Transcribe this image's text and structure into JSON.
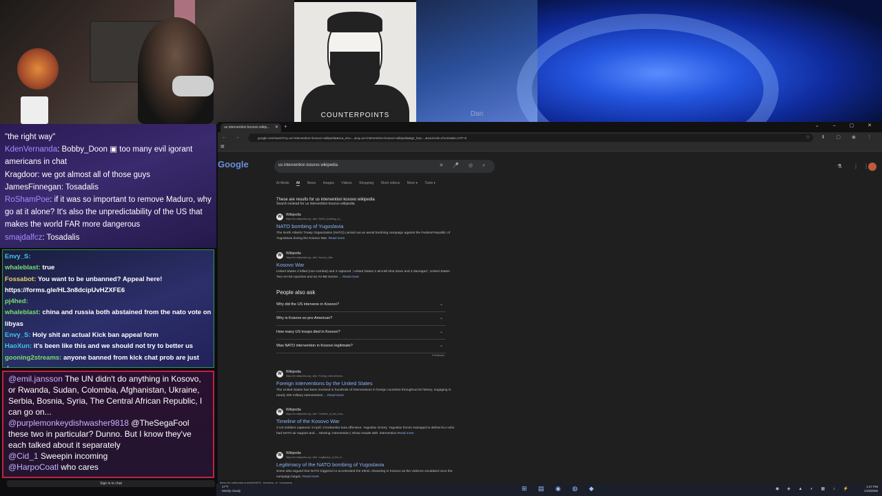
{
  "overlays": {
    "counterpoints_label": "COUNTERPOINTS",
    "dan_label": "Dan"
  },
  "chat_top": [
    {
      "user": "",
      "text": "\"the right way\""
    },
    {
      "user": "KdenVernanda",
      "text": ": Bobby_Doon ▣ too many evil igorant americans in chat"
    },
    {
      "user": "",
      "text": "Kragdoor: we got almost all of those guys"
    },
    {
      "user": "",
      "text": "JamesFinnegan: Tosadalis"
    },
    {
      "user": "RoShamPoe",
      "text": ": if it was so important to remove Maduro, why go at it alone? It's also the unpredictability of the US that makes the world FAR more dangerous"
    },
    {
      "user": "smajdalfcz",
      "text": ": Tosadalis"
    }
  ],
  "chat_mid": [
    {
      "user": "Envy_S:",
      "text": ""
    },
    {
      "user": "whaleblast:",
      "text": "true"
    },
    {
      "user": "Fossabot:",
      "text": "You want to be unbanned? Appeal here! https://forms.gle/HL3n8dcipUvHZXFE6"
    },
    {
      "user": "pj4hed:",
      "text": ""
    },
    {
      "user": "whaleblast:",
      "text": "china and russia both abstained from the nato vote on libyas"
    },
    {
      "user": "Envy_S:",
      "text": "Holy shit an actual Kick ban appeal form"
    },
    {
      "user": "HaoXun:",
      "text": "it's been like this and we should not try to better us"
    },
    {
      "user": "gooning2streams:",
      "text": "anyone banned from kick chat prob are just degens"
    }
  ],
  "chat_bottom": [
    {
      "user": "@emil.jansson",
      "text": " The UN didn't do anything in Kosovo, or Rwanda, Sudan, Colombia, Afghanistan, Ukraine, Serbia, Bosnia, Syria, The Central African Republic, I can go on..."
    },
    {
      "user": "@purplemonkeydishwasher9818",
      "text": " @TheSegaFool these two in particular? Dunno. But I know they've each talked about it separately"
    },
    {
      "user": "@Cid_1",
      "text": " Sweepin incoming"
    },
    {
      "user": "@HarpoCoatl",
      "text": " who cares"
    }
  ],
  "signin_label": "Sign in to chat",
  "browser": {
    "tab_title": "us intervention kosovo wikip...",
    "url": "google.com/search?q=us+intervention+kosovo+wikipedia&sca_esv=...&oq=us+intervention+kosovo+wikipedia&gs_lcrp=...&sourceid=chrome&ie=UTF-8",
    "logo": "Google",
    "query": "us intervention kosovo wikipedia",
    "filters": [
      "AI Mode",
      "All",
      "News",
      "Images",
      "Videos",
      "Shopping",
      "Short videos",
      "More ▾",
      "Tools ▾"
    ],
    "results_note": "These are results for us intervention kosovo wikipedia",
    "search_instead": "Search instead for us intervention kosovo wikipedia",
    "results": [
      {
        "site": "Wikipedia",
        "url": "https://en.wikipedia.org › wiki › NATO_bombing_of_...",
        "title": "NATO bombing of Yugoslavia",
        "snippet": "The North Atlantic Treaty Organization (NATO) carried out an aerial bombing campaign against the Federal Republic of Yugoslavia during the Kosovo War.",
        "more": "Read more"
      },
      {
        "site": "Wikipedia",
        "url": "https://en.wikipedia.org › wiki › Kosovo_War",
        "title": "Kosovo War",
        "snippet": "United States 2 killed (non-combat) and 3 captured ; United States 2 aircraft shot down and 3 damaged ; United States Two AH-64 Apaches and an AV-8B Harrier ...",
        "more": "Read more"
      },
      {
        "site": "Wikipedia",
        "url": "https://en.wikipedia.org › wiki › Foreign_interventions...",
        "title": "Foreign interventions by the United States",
        "snippet": "The United States has been involved in hundreds of interventions in foreign countries throughout its history, engaging in nearly 400 military interventions ...",
        "more": "Read more"
      },
      {
        "site": "Wikipedia",
        "url": "https://en.wikipedia.org › wiki › Timeline_of_the_Koso...",
        "title": "Timeline of the Kosovo War",
        "snippet": "3 US soldiers captured. 6 April: Crnobarska Suia offensive. Yugoslav victory. Yugoslav forces managed to defeat KLA who had NATO air support and ... Missing: intervention | Show results with: intervention",
        "more": "Read more"
      },
      {
        "site": "Wikipedia",
        "url": "https://en.wikipedia.org › wiki › Legitimacy_of_the_N...",
        "title": "Legitimacy of the NATO bombing of Yugoslavia",
        "snippet": "Some also argued that NATO triggered or accelerated the ethnic cleansing in Kosovo as the violence escalated once the campaign began.",
        "more": "Read more"
      }
    ],
    "paa_title": "People also ask",
    "paa": [
      "Why did the US intervene in Kosovo?",
      "Why is Kosovo so pro-American?",
      "How many US troops died in Kosovo?",
      "Was NATO intervention in Kosovo legitimate?"
    ],
    "feedback": "Feedback",
    "status_url": "https://en.wikipedia.org/wiki/NATO_bombing_of_Yugoslavia"
  },
  "taskbar": {
    "weather_temp": "17°F",
    "weather_desc": "Mostly cloudy",
    "time": "1:27 PM",
    "date": "1/19/2026"
  }
}
